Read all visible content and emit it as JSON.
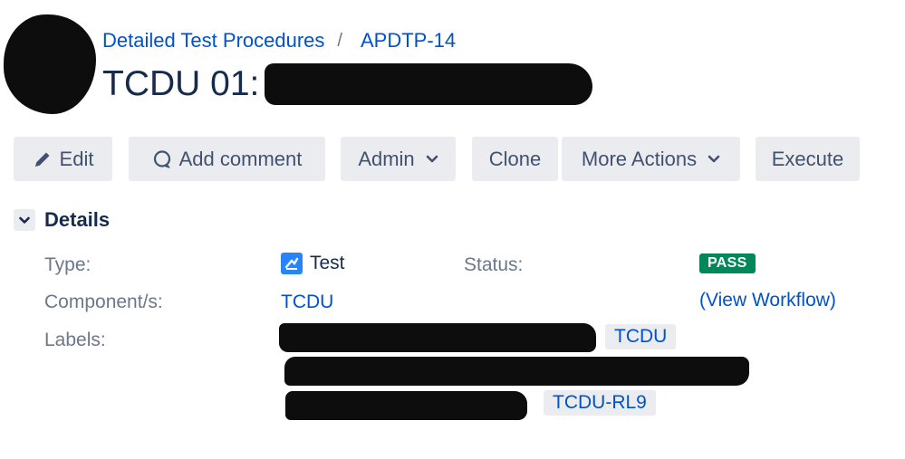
{
  "header": {
    "breadcrumb": [
      "Detailed Test Procedures",
      "APDTP-14"
    ],
    "separator": "/",
    "title_prefix": "TCDU 01:"
  },
  "toolbar": {
    "edit": "Edit",
    "add_comment": "Add comment",
    "admin": "Admin",
    "clone": "Clone",
    "more_actions": "More Actions",
    "execute": "Execute"
  },
  "details": {
    "heading": "Details",
    "type_label": "Type:",
    "type_value": "Test",
    "component_label": "Component/s:",
    "component_value": "TCDU",
    "labels_label": "Labels:",
    "labels": [
      "TCDU",
      "TCDU-RL9"
    ],
    "status_label": "Status:",
    "status_value": "PASS",
    "status_color": "#00875a",
    "view_workflow": "(View Workflow)"
  },
  "icons": [
    "pencil-icon",
    "comment-icon",
    "chevron-down-icon",
    "test-type-icon"
  ],
  "colors": {
    "link": "#0052cc",
    "button_bg": "#ebecf0",
    "text": "#172b4d",
    "label": "#6b778c"
  }
}
